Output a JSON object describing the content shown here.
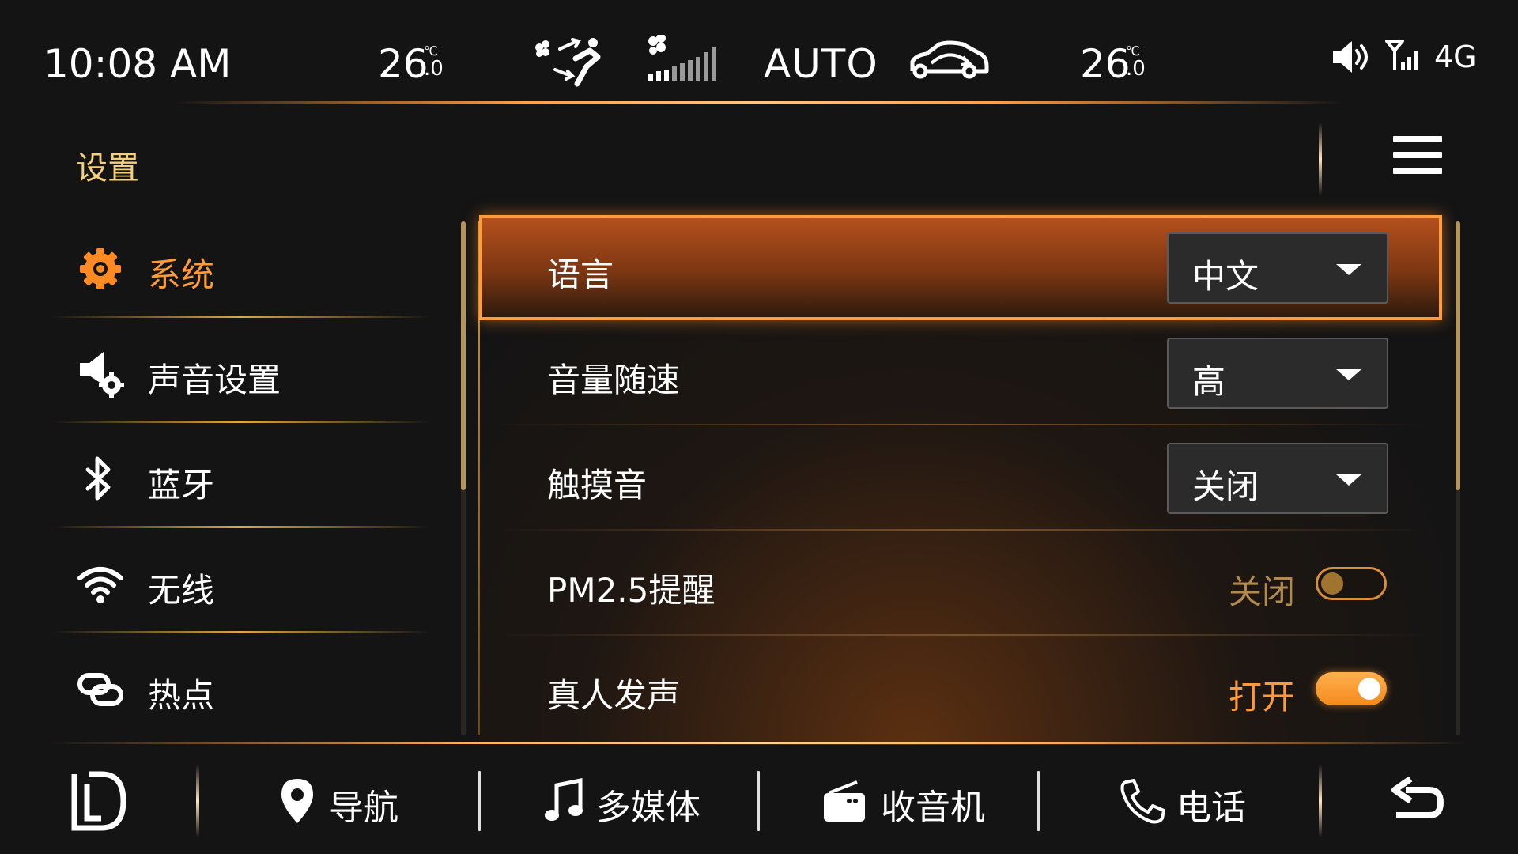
{
  "status": {
    "time": "10:08 AM",
    "temp_left": "26",
    "temp_left_decimal": ".0",
    "temp_right": "26",
    "temp_right_decimal": ".0",
    "temp_unit": "℃",
    "ac_mode": "AUTO",
    "network": "4G",
    "icons": [
      "airflow-icon",
      "fan-speed-icon",
      "car-recirculation-icon",
      "volume-icon",
      "signal-icon"
    ]
  },
  "header": {
    "title": "设置",
    "menu_icon": "hamburger-menu-icon"
  },
  "sidebar": {
    "items": [
      {
        "label": "系统",
        "icon": "gear-icon",
        "active": true
      },
      {
        "label": "声音设置",
        "icon": "speaker-settings-icon",
        "active": false
      },
      {
        "label": "蓝牙",
        "icon": "bluetooth-icon",
        "active": false
      },
      {
        "label": "无线",
        "icon": "wifi-icon",
        "active": false
      },
      {
        "label": "热点",
        "icon": "hotspot-link-icon",
        "active": false
      }
    ]
  },
  "settings": {
    "rows": [
      {
        "label": "语言",
        "type": "dropdown",
        "value": "中文",
        "selected": true
      },
      {
        "label": "音量随速",
        "type": "dropdown",
        "value": "高",
        "selected": false
      },
      {
        "label": "触摸音",
        "type": "dropdown",
        "value": "关闭",
        "selected": false
      },
      {
        "label": "PM2.5提醒",
        "type": "toggle",
        "state_text": "关闭",
        "on": false
      },
      {
        "label": "真人发声",
        "type": "toggle",
        "state_text": "打开",
        "on": true
      }
    ]
  },
  "bottom_nav": {
    "home_icon": "brand-logo-icon",
    "items": [
      {
        "label": "导航",
        "icon": "location-pin-icon"
      },
      {
        "label": "多媒体",
        "icon": "music-note-icon"
      },
      {
        "label": "收音机",
        "icon": "radio-icon"
      },
      {
        "label": "电话",
        "icon": "phone-icon"
      }
    ],
    "back_icon": "back-arrow-icon"
  },
  "colors": {
    "accent": "#ff9a3a",
    "title": "#f4cf7e",
    "background": "#141414"
  }
}
